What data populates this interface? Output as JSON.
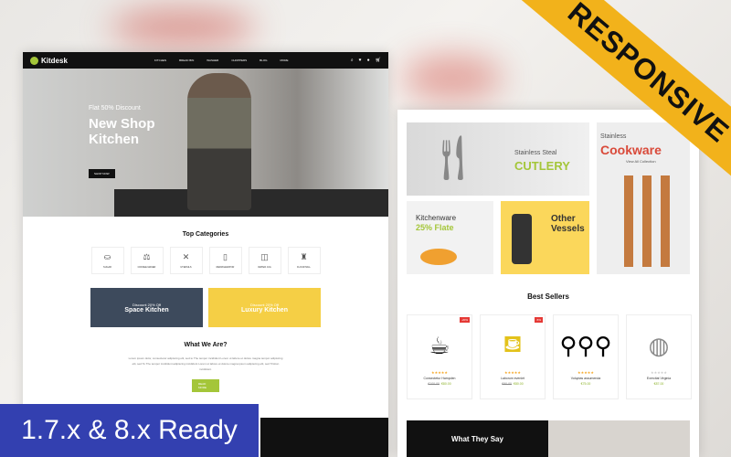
{
  "ribbon": "RESPONSIVE",
  "badge": "1.7.x & 8.x Ready",
  "colors": {
    "accent": "#a4c639",
    "ribbon": "#f2b21b",
    "badge": "#3340b0"
  },
  "nav": {
    "logo": "Kitdesk",
    "menu": [
      "KITCHEN",
      "BREAD BIN",
      "WASHER",
      "CHOPPERS",
      "BLOG",
      "MORE"
    ],
    "icons": [
      "search-icon",
      "heart-icon",
      "user-icon",
      "cart-icon"
    ]
  },
  "hero": {
    "subtitle": "Flat 50% Discount",
    "title": "New Shop Kitchen",
    "button": "SHOP NOW"
  },
  "categories": {
    "title": "Top Categories",
    "items": [
      "SUGAR",
      "COFFEE MAKER",
      "UTENSILS",
      "REFRIGERATOR",
      "WATER JUG",
      "FLOUR MILL"
    ]
  },
  "banners": [
    {
      "small": "Discount 20% Off",
      "title": "Space Kitchen"
    },
    {
      "small": "Discount 20% Off",
      "title": "Luxury Kitchen"
    }
  ],
  "about": {
    "title": "What We Are?",
    "text": "Lorem ipsum dolor, consectetur adipiscing elit, sed to The tempor incididunt Lorem ut labore et dolore magna tempor adipiscing elit, sed To The tempor incididunt adipiscing incididunt Lorem ut labore et dolore magna ipsum adipiscing elit, sed Tristion incididunt.",
    "button": "READ MORE"
  },
  "tiles": {
    "cutlery_small": "Stainless Steal",
    "cutlery_big": "CUTLERY",
    "kitchenware": "Kitchenware",
    "kitchenware_off": "25% Flate",
    "vessels": "Other Vessels",
    "cookware_small": "Stainless",
    "cookware_big": "Cookware",
    "cookware_link": "View All Collection"
  },
  "best_sellers": {
    "title": "Best Sellers",
    "products": [
      {
        "name": "Consectetur Hampden",
        "old": "€100.00",
        "price": "€80.00",
        "sale": "-20%",
        "rating": 5
      },
      {
        "name": "Laborum eveniet",
        "old": "€90.00",
        "price": "€80.00",
        "sale": "-5%",
        "rating": 5
      },
      {
        "name": "Voluptas assumenda",
        "price": "€75.00",
        "rating": 5
      },
      {
        "name": "Exercitat Virginia",
        "price": "€87.00",
        "rating": 0
      }
    ]
  },
  "testimonials": {
    "title": "What They Say"
  }
}
